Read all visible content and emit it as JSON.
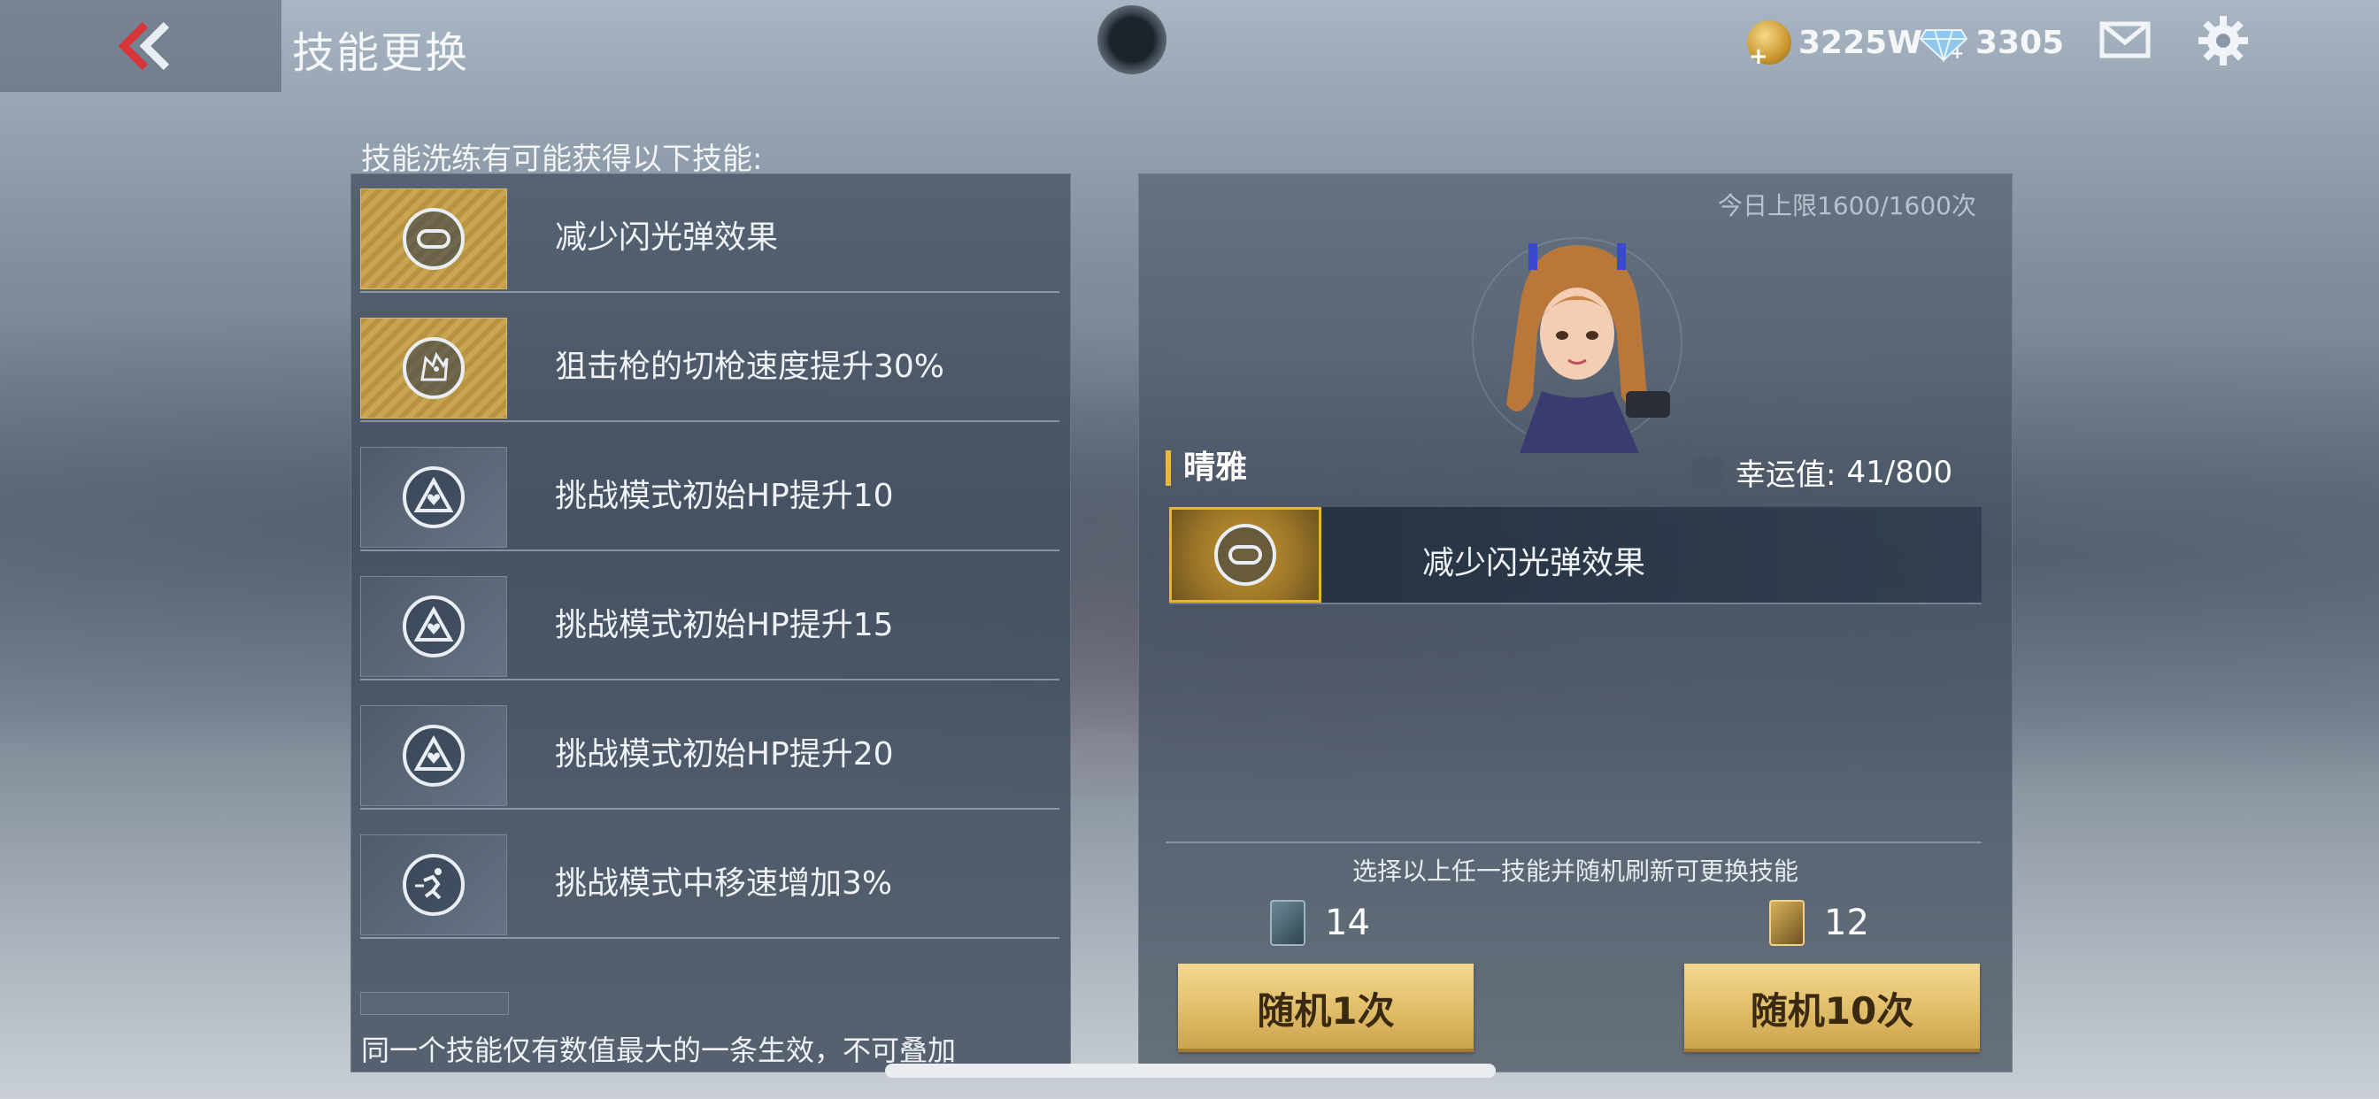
{
  "header": {
    "title": "技能更换",
    "gold_amount": "3225W",
    "diamond_amount": "3305",
    "icons": [
      "back-icon",
      "gold-coin-icon",
      "diamond-icon",
      "mail-icon",
      "gear-icon"
    ]
  },
  "skill_list": {
    "heading": "技能洗练有可能获得以下技能:",
    "items": [
      {
        "label": "减少闪光弹效果",
        "icon": "goggles-icon",
        "gold": true
      },
      {
        "label": "狙击枪的切枪速度提升30%",
        "icon": "wolf-icon",
        "gold": true
      },
      {
        "label": "挑战模式初始HP提升10",
        "icon": "triangle-heart-icon",
        "gold": false
      },
      {
        "label": "挑战模式初始HP提升15",
        "icon": "triangle-heart-icon",
        "gold": false
      },
      {
        "label": "挑战模式初始HP提升20",
        "icon": "triangle-heart-icon",
        "gold": false
      },
      {
        "label": "挑战模式中移速增加3%",
        "icon": "running-icon",
        "gold": false
      }
    ],
    "note": "同一个技能仅有数值最大的一条生效，不可叠加"
  },
  "detail": {
    "daily_limit": "今日上限1600/1600次",
    "character_name": "晴雅",
    "luck_label": "幸运值:",
    "luck_value": "41/800",
    "current_skill": "减少闪光弹效果",
    "hint": "选择以上任一技能并随机刷新可更换技能",
    "ticket_silver_count": "14",
    "ticket_gold_count": "12",
    "btn_once": "随机1次",
    "btn_ten": "随机10次"
  },
  "colors": {
    "accent_gold": "#e8b93a",
    "button_gold": "#e2bf6a"
  }
}
